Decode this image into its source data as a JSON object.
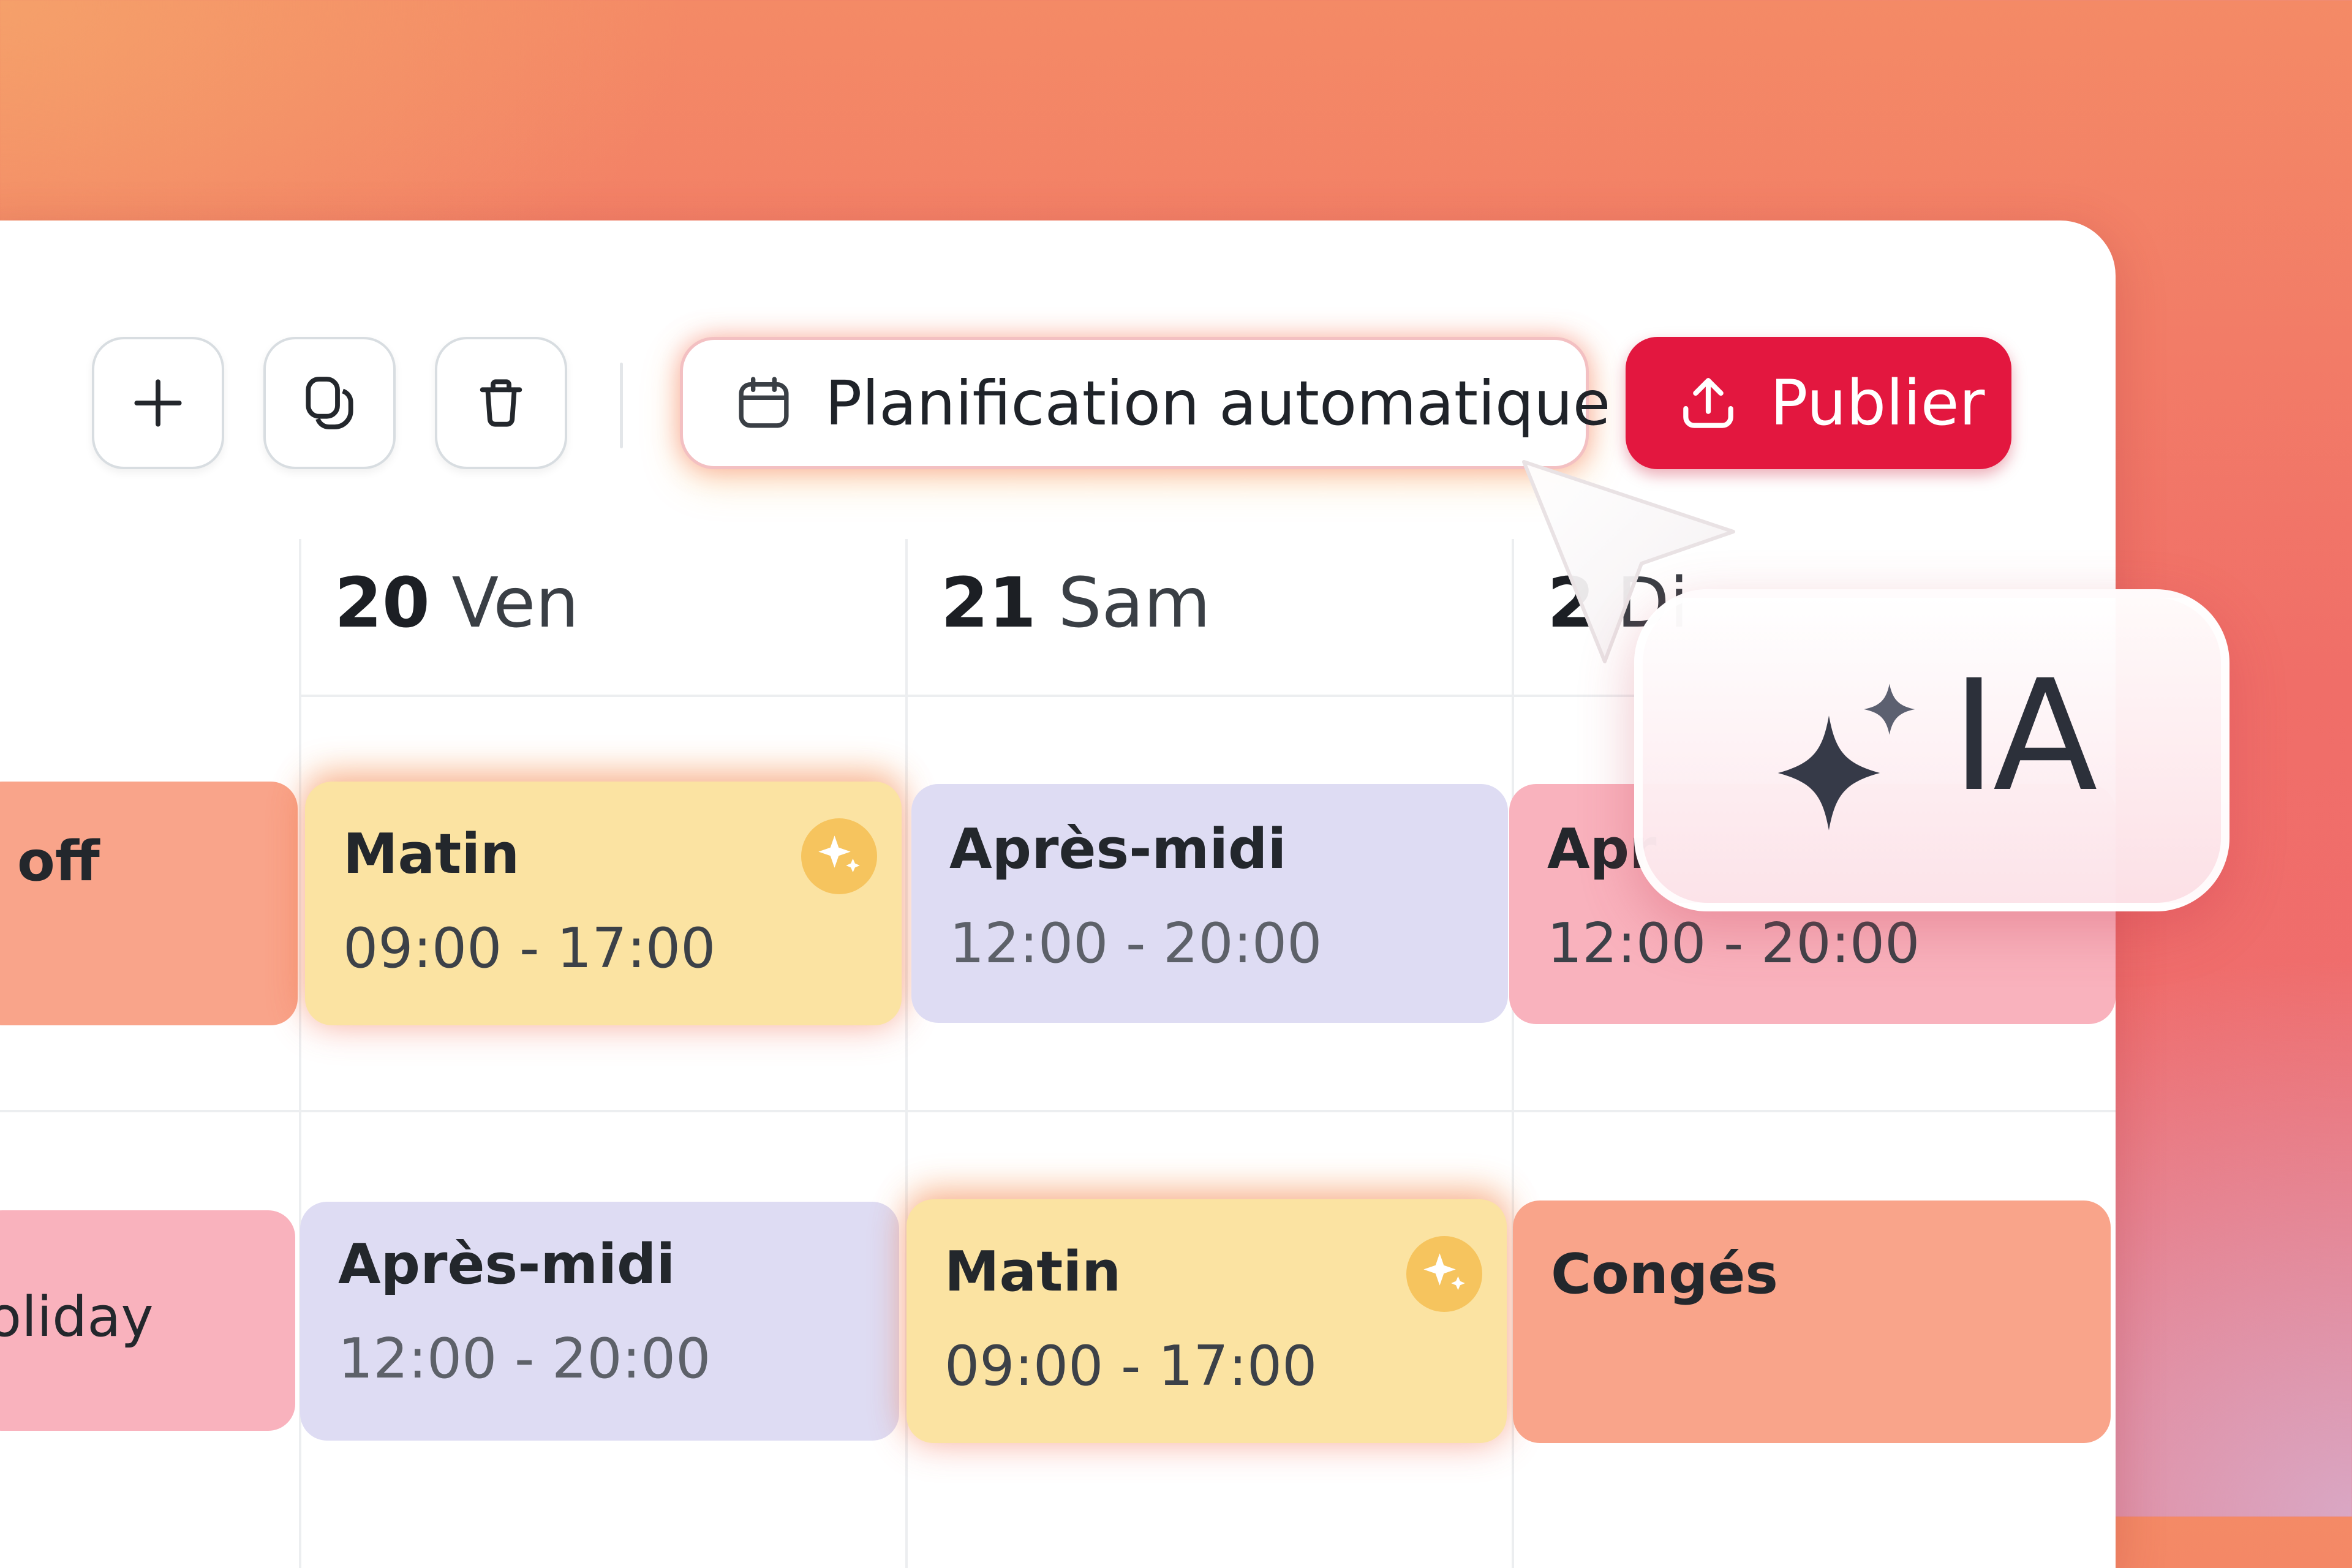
{
  "toolbar": {
    "add_icon": "plus-icon",
    "copy_icon": "copy-icon",
    "delete_icon": "trash-icon",
    "auto_schedule_label": "Planification automatique",
    "auto_schedule_icon": "calendar-icon",
    "publish_label": "Publier",
    "publish_icon": "upload-icon",
    "publish_color": "#e3173f"
  },
  "days": [
    {
      "num": "20",
      "name": "Ven"
    },
    {
      "num": "21",
      "name": "Sam"
    },
    {
      "num": "2",
      "name": "Di"
    }
  ],
  "rows": [
    {
      "left_label": "off",
      "shifts": [
        {
          "title": "Matin",
          "time": "09:00 - 17:00",
          "ai": true
        },
        {
          "title": "Après-midi",
          "time": "12:00 - 20:00"
        },
        {
          "title": "Apr",
          "time": "12:00 - 20:00"
        }
      ]
    },
    {
      "left_label": "oliday",
      "shifts": [
        {
          "title": "Après-midi",
          "time": "12:00 - 20:00"
        },
        {
          "title": "Matin",
          "time": "09:00 - 17:00",
          "ai": true
        },
        {
          "title": "Congés"
        }
      ]
    }
  ],
  "ai_chip": {
    "label": "IA",
    "icon": "sparkle-icon"
  },
  "colors": {
    "morning": "#fbe3a2",
    "afternoon": "#dedcf3",
    "afternoon_pink": "#f9b2bd",
    "leave": "#f9a48a",
    "ai_badge": "#f6c45e"
  }
}
